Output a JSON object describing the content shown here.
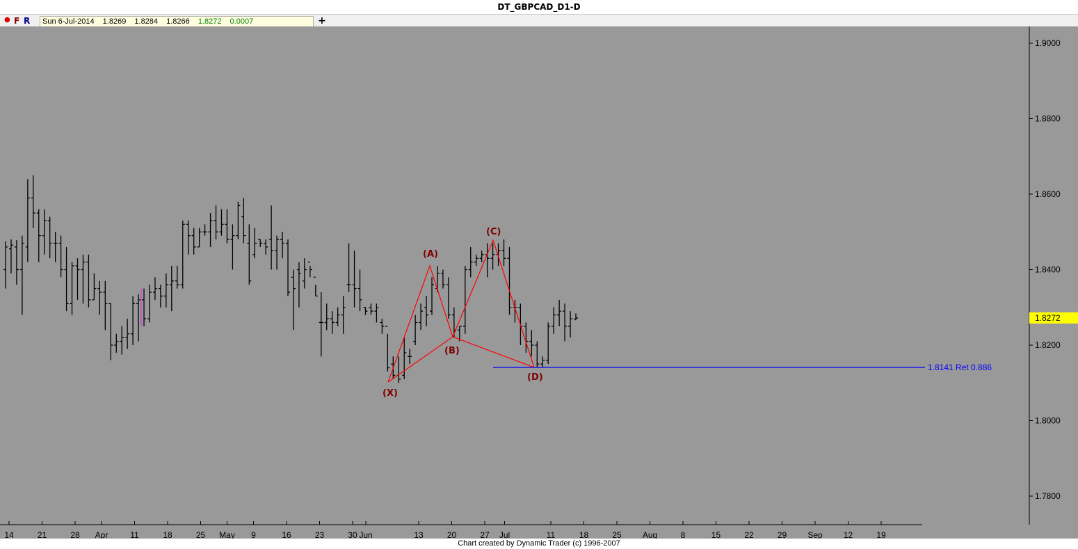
{
  "window": {
    "title": "DT_GBPCAD_D1-D"
  },
  "toolbar": {
    "dot_icon": "red-dot-icon",
    "f_label": "F",
    "r_label": "R",
    "info": {
      "date": "Sun 6-Jul-2014",
      "open": "1.8269",
      "high": "1.8284",
      "low": "1.8266",
      "close": "1.8272",
      "change": "0.0007"
    },
    "plus_label": "+"
  },
  "footer": {
    "text": "Chart created by Dynamic Trader  (c) 1996-2007"
  },
  "colors": {
    "background": "#999999",
    "bars": "#000000",
    "pattern": "#ff0000",
    "pattern_labels": "#800000",
    "projection": "#0000ff",
    "price_marker": "#ffff00",
    "highlight_bar": "#cc44cc"
  },
  "chart_data": {
    "type": "ohlc",
    "title": "DT_GBPCAD_D1-D",
    "ylim": [
      1.772,
      1.905
    ],
    "yticks": [
      1.9,
      1.88,
      1.86,
      1.84,
      1.82,
      1.8,
      1.78
    ],
    "ytick_labels": [
      "1.9000",
      "1.8800",
      "1.8600",
      "1.8400",
      "1.8200",
      "1.8000",
      "1.7800"
    ],
    "xticks": [
      {
        "label": "14",
        "day": 0
      },
      {
        "label": "21",
        "day": 5
      },
      {
        "label": "28",
        "day": 10
      },
      {
        "label": "Apr",
        "day": 14
      },
      {
        "label": "11",
        "day": 19
      },
      {
        "label": "18",
        "day": 24
      },
      {
        "label": "25",
        "day": 29
      },
      {
        "label": "May",
        "day": 33
      },
      {
        "label": "9",
        "day": 37
      },
      {
        "label": "16",
        "day": 42
      },
      {
        "label": "23",
        "day": 47
      },
      {
        "label": "30",
        "day": 52
      },
      {
        "label": "Jun",
        "day": 54
      },
      {
        "label": "13",
        "day": 62
      },
      {
        "label": "20",
        "day": 67
      },
      {
        "label": "27",
        "day": 72
      },
      {
        "label": "Jul",
        "day": 75
      },
      {
        "label": "11",
        "day": 82
      },
      {
        "label": "18",
        "day": 87
      },
      {
        "label": "25",
        "day": 92
      },
      {
        "label": "Aug",
        "day": 97
      },
      {
        "label": "8",
        "day": 102
      },
      {
        "label": "15",
        "day": 107
      },
      {
        "label": "22",
        "day": 112
      },
      {
        "label": "29",
        "day": 117
      },
      {
        "label": "Sep",
        "day": 122
      },
      {
        "label": "12",
        "day": 127
      },
      {
        "label": "19",
        "day": 132
      }
    ],
    "bars": [
      {
        "o": 1.84,
        "h": 1.8475,
        "l": 1.835,
        "c": 1.846
      },
      {
        "o": 1.8455,
        "h": 1.848,
        "l": 1.839,
        "c": 1.8465
      },
      {
        "o": 1.846,
        "h": 1.8478,
        "l": 1.836,
        "c": 1.84
      },
      {
        "o": 1.84,
        "h": 1.849,
        "l": 1.828,
        "c": 1.847
      },
      {
        "o": 1.846,
        "h": 1.864,
        "l": 1.842,
        "c": 1.859
      },
      {
        "o": 1.859,
        "h": 1.865,
        "l": 1.851,
        "c": 1.855
      },
      {
        "o": 1.855,
        "h": 1.856,
        "l": 1.842,
        "c": 1.849
      },
      {
        "o": 1.849,
        "h": 1.856,
        "l": 1.844,
        "c": 1.853
      },
      {
        "o": 1.853,
        "h": 1.854,
        "l": 1.843,
        "c": 1.847
      },
      {
        "o": 1.847,
        "h": 1.85,
        "l": 1.842,
        "c": 1.847
      },
      {
        "o": 1.847,
        "h": 1.849,
        "l": 1.838,
        "c": 1.84
      },
      {
        "o": 1.84,
        "h": 1.846,
        "l": 1.829,
        "c": 1.831
      },
      {
        "o": 1.831,
        "h": 1.842,
        "l": 1.828,
        "c": 1.841
      },
      {
        "o": 1.841,
        "h": 1.843,
        "l": 1.832,
        "c": 1.84
      },
      {
        "o": 1.84,
        "h": 1.844,
        "l": 1.831,
        "c": 1.842
      },
      {
        "o": 1.842,
        "h": 1.844,
        "l": 1.83,
        "c": 1.832
      },
      {
        "o": 1.832,
        "h": 1.839,
        "l": 1.832,
        "c": 1.835
      },
      {
        "o": 1.835,
        "h": 1.837,
        "l": 1.828,
        "c": 1.834
      },
      {
        "o": 1.834,
        "h": 1.837,
        "l": 1.824,
        "c": 1.831
      },
      {
        "o": 1.831,
        "h": 1.831,
        "l": 1.816,
        "c": 1.82
      },
      {
        "o": 1.82,
        "h": 1.823,
        "l": 1.818,
        "c": 1.821
      },
      {
        "o": 1.821,
        "h": 1.825,
        "l": 1.8175,
        "c": 1.822
      },
      {
        "o": 1.822,
        "h": 1.827,
        "l": 1.819,
        "c": 1.823
      },
      {
        "o": 1.823,
        "h": 1.833,
        "l": 1.82,
        "c": 1.831
      },
      {
        "o": 1.831,
        "h": 1.8335,
        "l": 1.821,
        "c": 1.832
      },
      {
        "o": 1.832,
        "h": 1.835,
        "l": 1.825,
        "c": 1.827
      },
      {
        "o": 1.827,
        "h": 1.836,
        "l": 1.826,
        "c": 1.834
      },
      {
        "o": 1.834,
        "h": 1.838,
        "l": 1.832,
        "c": 1.835
      },
      {
        "o": 1.835,
        "h": 1.836,
        "l": 1.83,
        "c": 1.833
      },
      {
        "o": 1.833,
        "h": 1.839,
        "l": 1.83,
        "c": 1.836
      },
      {
        "o": 1.836,
        "h": 1.841,
        "l": 1.829,
        "c": 1.837
      },
      {
        "o": 1.837,
        "h": 1.841,
        "l": 1.835,
        "c": 1.836
      },
      {
        "o": 1.836,
        "h": 1.853,
        "l": 1.835,
        "c": 1.852
      },
      {
        "o": 1.852,
        "h": 1.853,
        "l": 1.844,
        "c": 1.849
      },
      {
        "o": 1.849,
        "h": 1.851,
        "l": 1.844,
        "c": 1.846
      },
      {
        "o": 1.846,
        "h": 1.851,
        "l": 1.846,
        "c": 1.85
      },
      {
        "o": 1.85,
        "h": 1.852,
        "l": 1.849,
        "c": 1.85
      },
      {
        "o": 1.85,
        "h": 1.855,
        "l": 1.846,
        "c": 1.853
      },
      {
        "o": 1.853,
        "h": 1.857,
        "l": 1.848,
        "c": 1.85
      },
      {
        "o": 1.85,
        "h": 1.856,
        "l": 1.849,
        "c": 1.852
      }
    ]
  },
  "highlight_bar": {
    "day": 18,
    "high": 1.835,
    "low": 1.825
  },
  "pattern": {
    "points": [
      {
        "label": "(X)",
        "day": 63,
        "price": 1.8102
      },
      {
        "label": "(A)",
        "day": 73,
        "price": 1.841
      },
      {
        "label": "(B)",
        "day": 77,
        "price": 1.8222
      },
      {
        "label": "(C)",
        "day": 84,
        "price": 1.8478
      },
      {
        "label": "(D)",
        "day": 91,
        "price": 1.8141
      }
    ]
  },
  "projection": {
    "price": 1.8141,
    "label": "1.8141 Ret 0.886",
    "from_day": 84,
    "to_day": 138
  },
  "last_price": {
    "value": 1.8272,
    "label": "1.8272"
  }
}
